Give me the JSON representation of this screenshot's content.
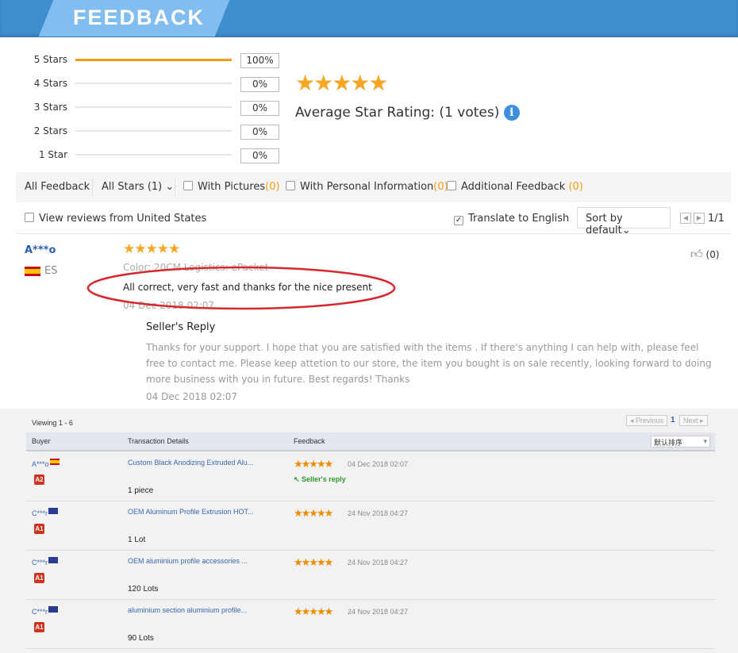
{
  "header": {
    "title": "FEEDBACK"
  },
  "ratings": [
    {
      "label": "5 Stars",
      "pct": "100%",
      "fill": 100
    },
    {
      "label": "4 Stars",
      "pct": "0%",
      "fill": 0
    },
    {
      "label": "3 Stars",
      "pct": "0%",
      "fill": 0
    },
    {
      "label": "2 Stars",
      "pct": "0%",
      "fill": 0
    },
    {
      "label": "1 Star",
      "pct": "0%",
      "fill": 0
    }
  ],
  "summary": {
    "stars": "★★★★★",
    "average_label": "Average Star Rating:  (1 votes)",
    "info_icon": "i"
  },
  "filters": {
    "all_feedback": "All Feedback",
    "all_stars": "All Stars (1)",
    "with_pictures": "With Pictures",
    "with_pictures_count": "(0)",
    "with_personal": "With Personal Information",
    "with_personal_count": "(0)",
    "additional": "Additional Feedback",
    "additional_count": "(0)",
    "view_us": "View reviews from United States",
    "translate": "Translate to English",
    "translate_checked": true,
    "sort": "Sort by default",
    "page": "1/1"
  },
  "review": {
    "buyer": "A***o",
    "country": "ES",
    "stars": "★★★★★",
    "meta": "Color: 20CM    Logistics: ePacket",
    "text": "All correct, very fast and thanks for the nice present",
    "date": "04 Dec 2018 02:07",
    "likes": "(0)",
    "reply_title": "Seller's Reply",
    "reply_text": "Thanks for your support. I hope that you are satisfied with the items . If there's anything I can help with, please feel free to contact me. Please keep attetion to our store, the item you bought is on sale recently, looking forward to doing more business with you in future. Best regards! Thanks",
    "reply_date": "04 Dec 2018 02:07",
    "annotation_color": "#d9262e"
  },
  "table": {
    "viewing": "Viewing 1 - 6",
    "prev": "◂ Previous",
    "page": "1",
    "next": "Next ▸",
    "columns": [
      "Buyer",
      "Transaction Details",
      "Feedback"
    ],
    "sort": "默认排序",
    "rows": [
      {
        "buyer": "A***o",
        "flag": "ES",
        "badge": "A2",
        "product": "Custom Black Anodizing Extruded Alu...",
        "qty": "1 piece",
        "stars": "★★★★★",
        "date": "04 Dec 2018 02:07",
        "reply": "↖ Seller's reply"
      },
      {
        "buyer": "C***r",
        "flag": "AU",
        "badge": "A1",
        "product": "OEM Aluminum Profile Extrusion HOT...",
        "qty": "1 Lot",
        "stars": "★★★★★",
        "date": "24 Nov 2018 04:27"
      },
      {
        "buyer": "C***r",
        "flag": "AU",
        "badge": "A1",
        "product": "OEM aluminium profile accessories ...",
        "qty": "120 Lots",
        "stars": "★★★★★",
        "date": "24 Nov 2018 04:27"
      },
      {
        "buyer": "C***r",
        "flag": "AU",
        "badge": "A1",
        "product": "aluminium section aluminium profile...",
        "qty": "90 Lots",
        "stars": "★★★★★",
        "date": "24 Nov 2018 04:27"
      }
    ]
  },
  "colors": {
    "header": "#3f8ed0",
    "header_tab": "#82bdef",
    "star": "#f5a623",
    "bar": "#f39c12",
    "link": "#3a66b0"
  }
}
